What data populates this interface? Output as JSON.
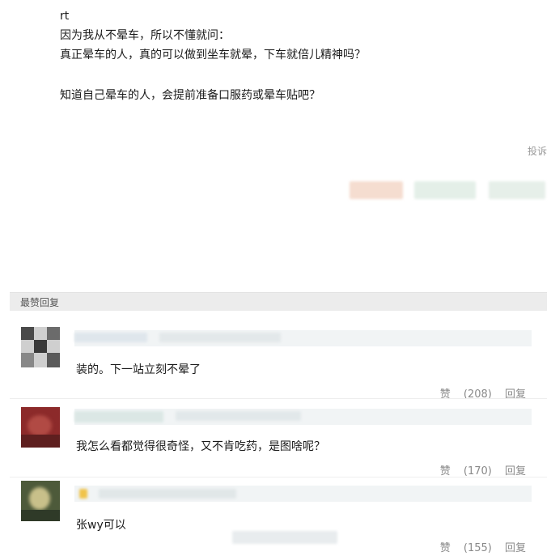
{
  "post": {
    "lines": [
      "rt",
      "因为我从不晕车，所以不懂就问：",
      "真正晕车的人，真的可以做到坐车就晕，下车就倍儿精神吗？",
      "知道自己晕车的人，会提前准备口服药或晕车贴吧？"
    ],
    "report_label": "投诉"
  },
  "replies": {
    "section_title": "最赞回复",
    "items": [
      {
        "text": "装的。下一站立刻不晕了",
        "like_label": "赞",
        "like_count": "(208)",
        "reply_label": "回复"
      },
      {
        "text": "我怎么看都觉得很奇怪，又不肯吃药，是图啥呢？",
        "like_label": "赞",
        "like_count": "(170)",
        "reply_label": "回复"
      },
      {
        "text": "张wy可以",
        "like_label": "赞",
        "like_count": "(155)",
        "reply_label": "回复"
      }
    ]
  },
  "colors": {
    "background": "#ffffff",
    "section_bar": "#ececec",
    "meta_text": "#8a8a8a"
  }
}
